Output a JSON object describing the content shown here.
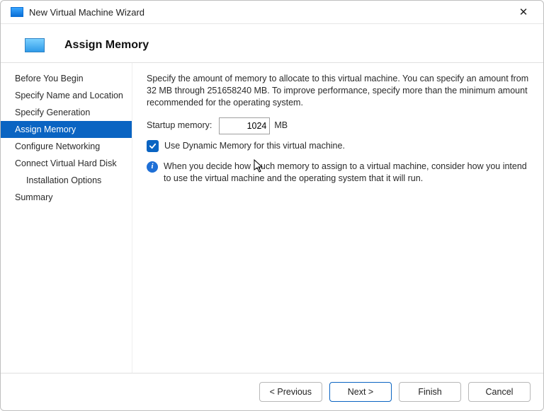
{
  "window": {
    "title": "New Virtual Machine Wizard"
  },
  "header": {
    "title": "Assign Memory"
  },
  "sidebar": {
    "items": [
      {
        "label": "Before You Begin",
        "active": false,
        "indent": false
      },
      {
        "label": "Specify Name and Location",
        "active": false,
        "indent": false
      },
      {
        "label": "Specify Generation",
        "active": false,
        "indent": false
      },
      {
        "label": "Assign Memory",
        "active": true,
        "indent": false
      },
      {
        "label": "Configure Networking",
        "active": false,
        "indent": false
      },
      {
        "label": "Connect Virtual Hard Disk",
        "active": false,
        "indent": false
      },
      {
        "label": "Installation Options",
        "active": false,
        "indent": true
      },
      {
        "label": "Summary",
        "active": false,
        "indent": false
      }
    ]
  },
  "content": {
    "intro": "Specify the amount of memory to allocate to this virtual machine. You can specify an amount from 32 MB through 251658240 MB. To improve performance, specify more than the minimum amount recommended for the operating system.",
    "startup_label": "Startup memory:",
    "startup_value": "1024",
    "startup_unit": "MB",
    "dynamic_checkbox_label": "Use Dynamic Memory for this virtual machine.",
    "dynamic_checked": true,
    "info_text": "When you decide how much memory to assign to a virtual machine, consider how you intend to use the virtual machine and the operating system that it will run."
  },
  "footer": {
    "previous": "< Previous",
    "next": "Next >",
    "finish": "Finish",
    "cancel": "Cancel"
  }
}
